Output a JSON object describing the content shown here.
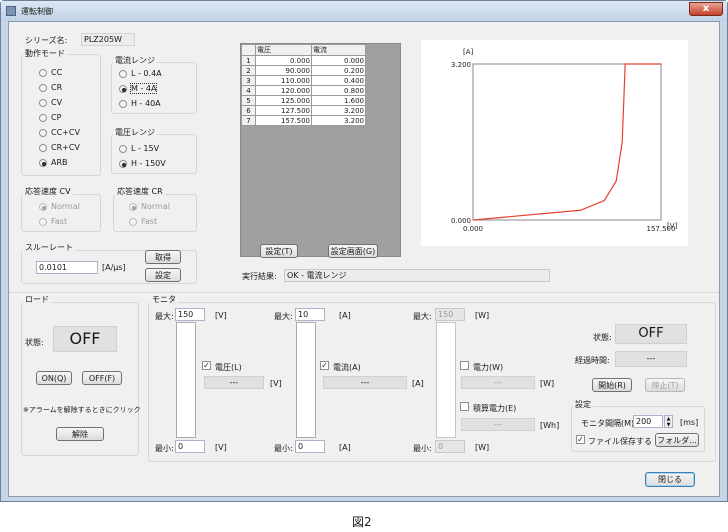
{
  "window": {
    "title": "運転制御",
    "close_glyph": "x"
  },
  "series": {
    "label": "シリーズ名:",
    "value": "PLZ205W"
  },
  "op_mode": {
    "title": "動作モード",
    "items": [
      {
        "label": "CC",
        "selected": false
      },
      {
        "label": "CR",
        "selected": false
      },
      {
        "label": "CV",
        "selected": false
      },
      {
        "label": "CP",
        "selected": false
      },
      {
        "label": "CC+CV",
        "selected": false
      },
      {
        "label": "CR+CV",
        "selected": false
      },
      {
        "label": "ARB",
        "selected": true
      }
    ]
  },
  "current_range": {
    "title": "電流レンジ",
    "items": [
      {
        "label": "L - 0.4A",
        "selected": false
      },
      {
        "label": "M - 4A",
        "selected": true
      },
      {
        "label": "H - 40A",
        "selected": false
      }
    ]
  },
  "voltage_range": {
    "title": "電圧レンジ",
    "items": [
      {
        "label": "L - 15V",
        "selected": false
      },
      {
        "label": "H - 150V",
        "selected": true
      }
    ]
  },
  "response_cv": {
    "title": "応答速度 CV",
    "items": [
      {
        "label": "Normal",
        "selected": true
      },
      {
        "label": "Fast",
        "selected": false
      }
    ]
  },
  "response_cr": {
    "title": "応答速度 CR",
    "items": [
      {
        "label": "Normal",
        "selected": true
      },
      {
        "label": "Fast",
        "selected": false
      }
    ]
  },
  "slew": {
    "title": "スルーレート",
    "value": "0.0101",
    "unit": "[A/μs]",
    "get_label": "取得",
    "set_label": "設定"
  },
  "table": {
    "headers": [
      "電圧",
      "電流"
    ],
    "rows": [
      {
        "n": "1",
        "v": "0.000",
        "i": "0.000"
      },
      {
        "n": "2",
        "v": "90.000",
        "i": "0.200"
      },
      {
        "n": "3",
        "v": "110.000",
        "i": "0.400"
      },
      {
        "n": "4",
        "v": "120.000",
        "i": "0.800"
      },
      {
        "n": "5",
        "v": "125.000",
        "i": "1.600"
      },
      {
        "n": "6",
        "v": "127.500",
        "i": "3.200"
      },
      {
        "n": "7",
        "v": "157.500",
        "i": "3.200"
      }
    ]
  },
  "table_buttons": {
    "set": "設定(T)",
    "set_screen": "設定画面(G)"
  },
  "result": {
    "label": "実行結果:",
    "value": "OK - 電流レンジ"
  },
  "chart_data": {
    "type": "line",
    "x": [
      0,
      90,
      110,
      120,
      125,
      127.5,
      157.5
    ],
    "series": [
      {
        "values": [
          0,
          0.2,
          0.4,
          0.8,
          1.6,
          3.2,
          3.2
        ],
        "color": "#e8402e"
      }
    ],
    "xlim": [
      0,
      157.5
    ],
    "ylim": [
      0,
      3.2
    ],
    "x_unit": "[V]",
    "y_unit": "[A]",
    "x_ticks": [
      "0.000",
      "157.500"
    ],
    "y_ticks": [
      "0.000",
      "3.200"
    ],
    "grid": false
  },
  "load": {
    "title": "ロード",
    "state_label": "状態:",
    "state_value": "OFF",
    "on_label": "ON(Q)",
    "off_label": "OFF(F)",
    "alarm_text": "※アラームを解除するときにクリック",
    "clear_label": "解除"
  },
  "monitor": {
    "title": "モニタ",
    "max_label": "最大:",
    "min_label": "最小:",
    "voltage": {
      "max": "150",
      "min": "0",
      "unit": "[V]",
      "check_label": "電圧(L)",
      "checked": true,
      "display": "---"
    },
    "current": {
      "max": "10",
      "min": "0",
      "unit": "[A]",
      "check_label": "電流(A)",
      "checked": true,
      "display": "---"
    },
    "power": {
      "max": "150",
      "min": "0",
      "unit": "[W]",
      "check_label": "電力(W)",
      "checked": false,
      "display": "---",
      "energy_label": "積算電力(E)",
      "energy_checked": false,
      "energy_display": "---",
      "energy_unit": "[Wh]"
    },
    "status_label": "状態:",
    "status_value": "OFF",
    "elapsed_label": "経過時間:",
    "elapsed_value": "---",
    "start_label": "開始(R)",
    "stop_label": "停止(T)",
    "settings_title": "設定",
    "interval_label": "モニタ間隔(M):",
    "interval_value": "200",
    "interval_unit": "[ms]",
    "save_file_label": "ファイル保存する",
    "save_file_checked": true,
    "folder_label": "フォルダ..."
  },
  "close_button": "閉じる",
  "caption": "図2"
}
